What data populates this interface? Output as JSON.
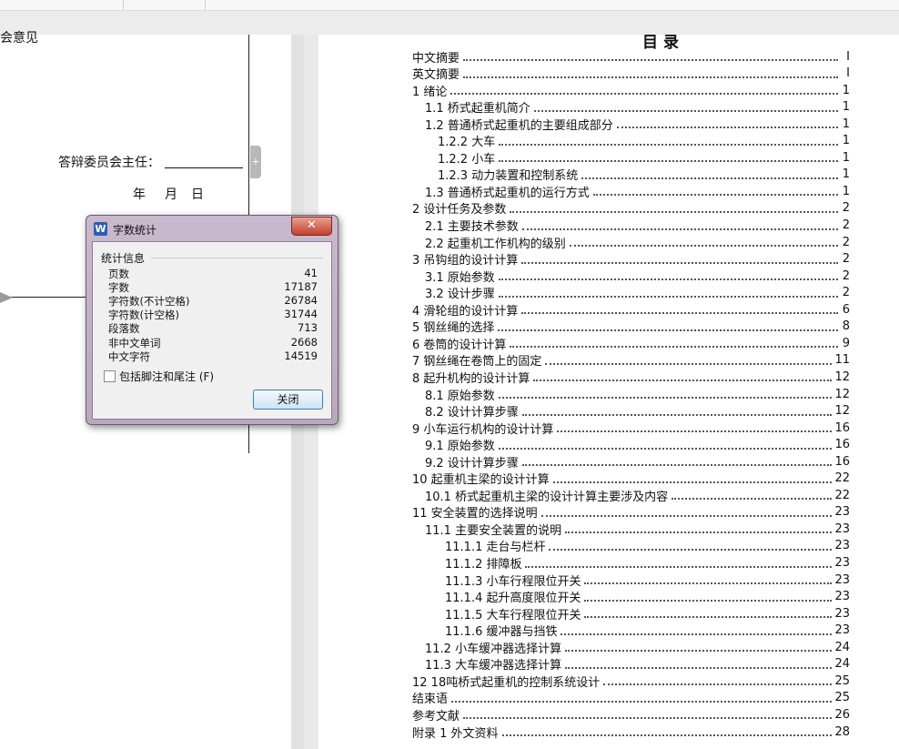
{
  "left_page": {
    "partial_heading": "员会意见",
    "chair_label": "答辩委员会主任：",
    "date_year": "年",
    "date_month": "月",
    "date_day": "日"
  },
  "toc": {
    "title": "目录",
    "entries": [
      {
        "title": "中文摘要",
        "page": "I",
        "level": 0
      },
      {
        "title": "英文摘要",
        "page": "I",
        "level": 0
      },
      {
        "title": "1 绪论",
        "page": "1",
        "level": 0
      },
      {
        "title": "1.1 桥式起重机简介",
        "page": "1",
        "level": 1
      },
      {
        "title": "1.2 普通桥式起重机的主要组成部分",
        "page": "1",
        "level": 1
      },
      {
        "title": "1.2.2 大车",
        "page": "1",
        "level": 2
      },
      {
        "title": "1.2.2 小车",
        "page": "1",
        "level": 2
      },
      {
        "title": "1.2.3 动力装置和控制系统",
        "page": "1",
        "level": 2
      },
      {
        "title": "1.3 普通桥式起重机的运行方式",
        "page": "1",
        "level": 1
      },
      {
        "title": "2 设计任务及参数",
        "page": "2",
        "level": 0
      },
      {
        "title": "2.1 主要技术参数",
        "page": "2",
        "level": 1
      },
      {
        "title": "2.2 起重机工作机构的级别",
        "page": "2",
        "level": 1
      },
      {
        "title": "3 吊钩组的设计计算",
        "page": "2",
        "level": 0
      },
      {
        "title": "3.1 原始参数",
        "page": "2",
        "level": 1
      },
      {
        "title": "3.2 设计步骤",
        "page": "2",
        "level": 1
      },
      {
        "title": "4 滑轮组的设计计算",
        "page": "6",
        "level": 0
      },
      {
        "title": "5 钢丝绳的选择",
        "page": "8",
        "level": 0
      },
      {
        "title": "6 卷筒的设计计算",
        "page": "9",
        "level": 0
      },
      {
        "title": "7 钢丝绳在卷筒上的固定",
        "page": "11",
        "level": 0
      },
      {
        "title": "8 起升机构的设计计算",
        "page": "12",
        "level": 0
      },
      {
        "title": "8.1 原始参数",
        "page": "12",
        "level": 1
      },
      {
        "title": "8.2 设计计算步骤",
        "page": "12",
        "level": 1
      },
      {
        "title": "9 小车运行机构的设计计算",
        "page": "16",
        "level": 0
      },
      {
        "title": "9.1 原始参数",
        "page": "16",
        "level": 1
      },
      {
        "title": "9.2 设计计算步骤",
        "page": "16",
        "level": 1
      },
      {
        "title": "10 起重机主梁的设计计算",
        "page": "22",
        "level": 0
      },
      {
        "title": "10.1 桥式起重机主梁的设计计算主要涉及内容",
        "page": "22",
        "level": 1
      },
      {
        "title": "11 安全装置的选择说明",
        "page": "23",
        "level": 0
      },
      {
        "title": "11.1 主要安全装置的说明",
        "page": "23",
        "level": 1
      },
      {
        "title": "11.1.1 走台与栏杆",
        "page": "23",
        "level": 3
      },
      {
        "title": "11.1.2 排障板",
        "page": "23",
        "level": 3
      },
      {
        "title": "11.1.3 小车行程限位开关",
        "page": "23",
        "level": 3
      },
      {
        "title": "11.1.4 起升高度限位开关",
        "page": "23",
        "level": 3
      },
      {
        "title": "11.1.5 大车行程限位开关",
        "page": "23",
        "level": 3
      },
      {
        "title": "11.1.6 缓冲器与挡铁",
        "page": "23",
        "level": 3
      },
      {
        "title": "11.2 小车缓冲器选择计算",
        "page": "24",
        "level": 1
      },
      {
        "title": "11.3 大车缓冲器选择计算",
        "page": "24",
        "level": 1
      },
      {
        "title": "12 18吨桥式起重机的控制系统设计",
        "page": "25",
        "level": 0
      },
      {
        "title": "结束语",
        "page": "25",
        "level": 0
      },
      {
        "title": "参考文献",
        "page": "26",
        "level": 0
      },
      {
        "title": "附录 1 外文资料",
        "page": "28",
        "level": 0
      }
    ]
  },
  "dialog": {
    "title": "字数统计",
    "app_icon": "W",
    "close_glyph": "✕",
    "group_label": "统计信息",
    "stats": [
      {
        "label": "页数",
        "value": "41"
      },
      {
        "label": "字数",
        "value": "17187"
      },
      {
        "label": "字符数(不计空格)",
        "value": "26784"
      },
      {
        "label": "字符数(计空格)",
        "value": "31744"
      },
      {
        "label": "段落数",
        "value": "713"
      },
      {
        "label": "非中文单词",
        "value": "2668"
      },
      {
        "label": "中文字符",
        "value": "14519"
      }
    ],
    "checkbox_label": "包括脚注和尾注",
    "checkbox_shortcut": "(F)",
    "checkbox_checked": false,
    "close_button": "关闭"
  }
}
